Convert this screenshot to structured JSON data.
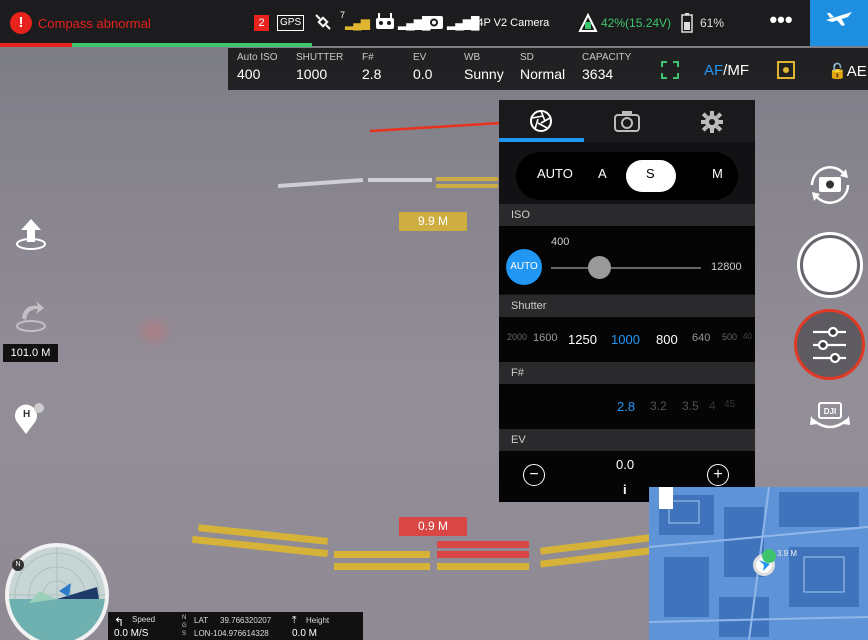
{
  "topbar": {
    "warning": "Compass abnormal",
    "gps_count": "2",
    "gps_label": "GPS",
    "satellite_count": "7",
    "camera_name": "P4P V2 Camera",
    "battery": "42%(15.24V)",
    "controller_battery": "61%",
    "more_label": "•••"
  },
  "params": [
    {
      "label": "Auto ISO",
      "value": "400"
    },
    {
      "label": "SHUTTER",
      "value": "1000"
    },
    {
      "label": "F#",
      "value": "2.8"
    },
    {
      "label": "EV",
      "value": "0.0"
    },
    {
      "label": "WB",
      "value": "Sunny"
    },
    {
      "label": "SD",
      "value": "Normal"
    },
    {
      "label": "CAPACITY",
      "value": "3634"
    }
  ],
  "params_buttons": {
    "af": "AF",
    "mf": "/MF",
    "ae": "AE"
  },
  "distance": {
    "top": "9.9 M",
    "bottom": "0.9 M"
  },
  "altitude": "101.0 M",
  "home_label": "H",
  "panel": {
    "modes": [
      "AUTO",
      "A",
      "S",
      "M"
    ],
    "active_mode": "S",
    "iso": {
      "section": "ISO",
      "auto_label": "AUTO",
      "value": "400",
      "max": "12800",
      "level": 0.28
    },
    "shutter": {
      "section": "Shutter",
      "values": [
        "2000",
        "1600",
        "1250",
        "1000",
        "800",
        "640",
        "500",
        "40"
      ],
      "selected": "1000"
    },
    "fnum": {
      "section": "F#",
      "values": [
        "2.8",
        "3.2",
        "3.5",
        "4",
        "45"
      ],
      "selected": "2.8"
    },
    "ev": {
      "section": "EV",
      "value": "0.0",
      "minus": "−",
      "plus": "+",
      "info": "i"
    }
  },
  "telemetry": {
    "speed_label": "Speed",
    "speed_value": "0.0 M/S",
    "lat_label": "LAT",
    "lat_value": "39.766320207",
    "lon_value": "LON-104.976614328",
    "height_label": "Height",
    "height_value": "0.0 M",
    "ngs": "N G S"
  },
  "map": {
    "distance_label": "3.9 M"
  },
  "colors": {
    "accent": "#2196f3",
    "warning": "#e8221c",
    "battery": "#3ec46d",
    "fly_button": "#1e8fe0",
    "record_ring": "#e03a26"
  }
}
